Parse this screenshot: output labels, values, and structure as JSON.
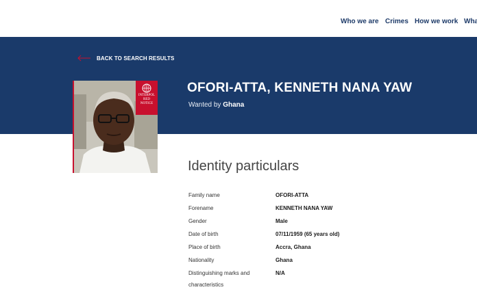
{
  "nav": {
    "items": [
      "Who we are",
      "Crimes",
      "How we work",
      "Wha"
    ]
  },
  "back_link": {
    "label": "BACK TO SEARCH RESULTS"
  },
  "badge": {
    "org": "INTERPOL",
    "line1": "RED",
    "line2": "NOTICE"
  },
  "person": {
    "title": "OFORI-ATTA, KENNETH NANA YAW",
    "wanted_prefix": "Wanted by",
    "wanted_by": "Ghana"
  },
  "identity": {
    "heading": "Identity particulars",
    "rows": [
      {
        "label": "Family name",
        "value": "OFORI-ATTA"
      },
      {
        "label": "Forename",
        "value": "KENNETH NANA YAW"
      },
      {
        "label": "Gender",
        "value": "Male"
      },
      {
        "label": "Date of birth",
        "value": "07/11/1959 (65 years old)"
      },
      {
        "label": "Place of birth",
        "value": "Accra, Ghana"
      },
      {
        "label": "Nationality",
        "value": "Ghana"
      },
      {
        "label": "Distinguishing marks and characteristics",
        "value": "N/A"
      }
    ]
  },
  "colors": {
    "banner": "#1a3a6a",
    "nav_text": "#1e3b69",
    "accent_red": "#c8102e"
  }
}
